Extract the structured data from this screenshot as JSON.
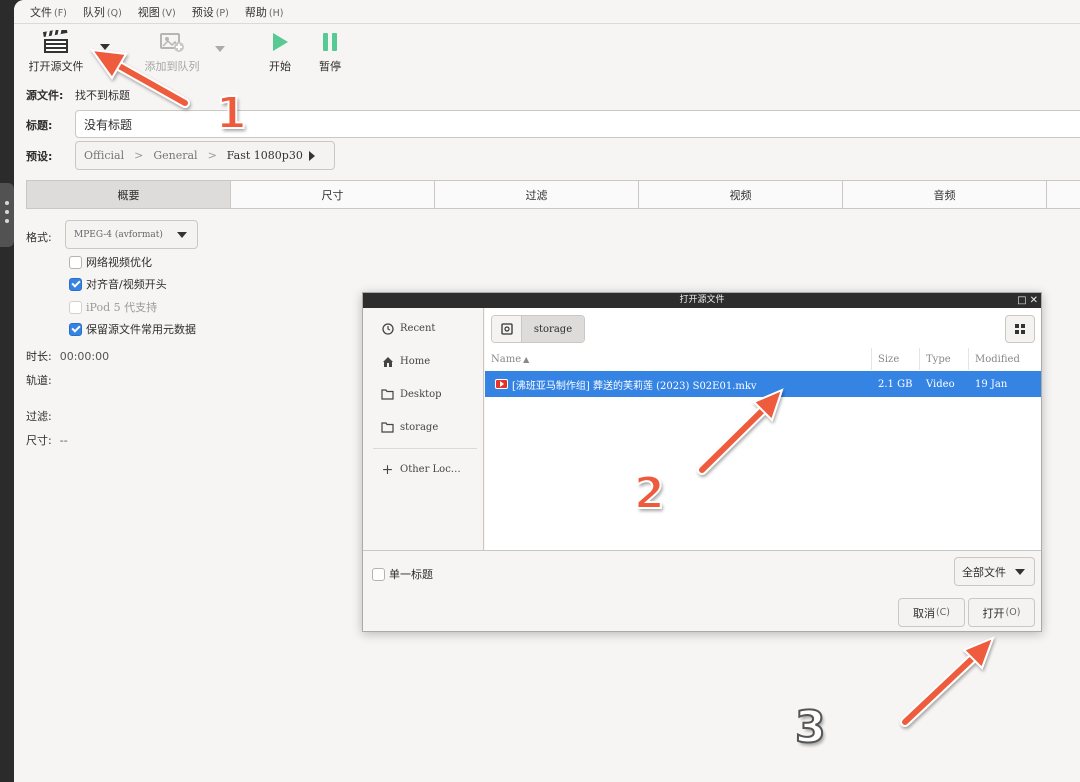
{
  "menu": [
    {
      "label": "文件",
      "mnemonic": "(F)"
    },
    {
      "label": "队列",
      "mnemonic": "(Q)"
    },
    {
      "label": "视图",
      "mnemonic": "(V)"
    },
    {
      "label": "预设",
      "mnemonic": "(P)"
    },
    {
      "label": "帮助",
      "mnemonic": "(H)"
    }
  ],
  "toolbar": {
    "open_source": "打开源文件",
    "add_to_queue": "添加到队列",
    "start": "开始",
    "pause": "暂停"
  },
  "source": {
    "label": "源文件:",
    "value": "找不到标题"
  },
  "title": {
    "label": "标题:",
    "value": "没有标题"
  },
  "preset": {
    "label": "预设:",
    "path": [
      "Official",
      "General",
      "Fast 1080p30"
    ]
  },
  "tabs": [
    "概要",
    "尺寸",
    "过滤",
    "视频",
    "音频"
  ],
  "summary": {
    "format_label": "格式:",
    "format_value": "MPEG-4 (avformat)",
    "options": [
      {
        "label": "网络视频优化",
        "checked": false,
        "enabled": true
      },
      {
        "label": "对齐音/视频开头",
        "checked": true,
        "enabled": true
      },
      {
        "label": "iPod 5 代支持",
        "checked": false,
        "enabled": false
      },
      {
        "label": "保留源文件常用元数据",
        "checked": true,
        "enabled": true
      }
    ],
    "duration_label": "时长:",
    "duration_value": "00:00:00",
    "tracks_label": "轨道:",
    "filters_label": "过滤:",
    "size_label": "尺寸:",
    "size_value": "--"
  },
  "dialog": {
    "title": "打开源文件",
    "places": [
      "Recent",
      "Home",
      "Desktop",
      "storage",
      "Other Loc…"
    ],
    "path_segment": "storage",
    "columns": {
      "name": "Name",
      "size": "Size",
      "type": "Type",
      "modified": "Modified"
    },
    "file": {
      "name": "[沸班亚马制作组] 葬送的芙莉莲 (2023) S02E01.mkv",
      "size": "2.1 GB",
      "type": "Video",
      "modified": "19 Jan"
    },
    "single_title_label": "单一标题",
    "filter_label": "全部文件",
    "cancel_label": "取消",
    "cancel_mnemonic": "(C)",
    "open_label": "打开",
    "open_mnemonic": "(O)"
  },
  "annotations": [
    "1",
    "2",
    "3"
  ],
  "colors": {
    "accent": "#3584e4",
    "arrow": "#ee5b3c",
    "play": "#57c993"
  }
}
